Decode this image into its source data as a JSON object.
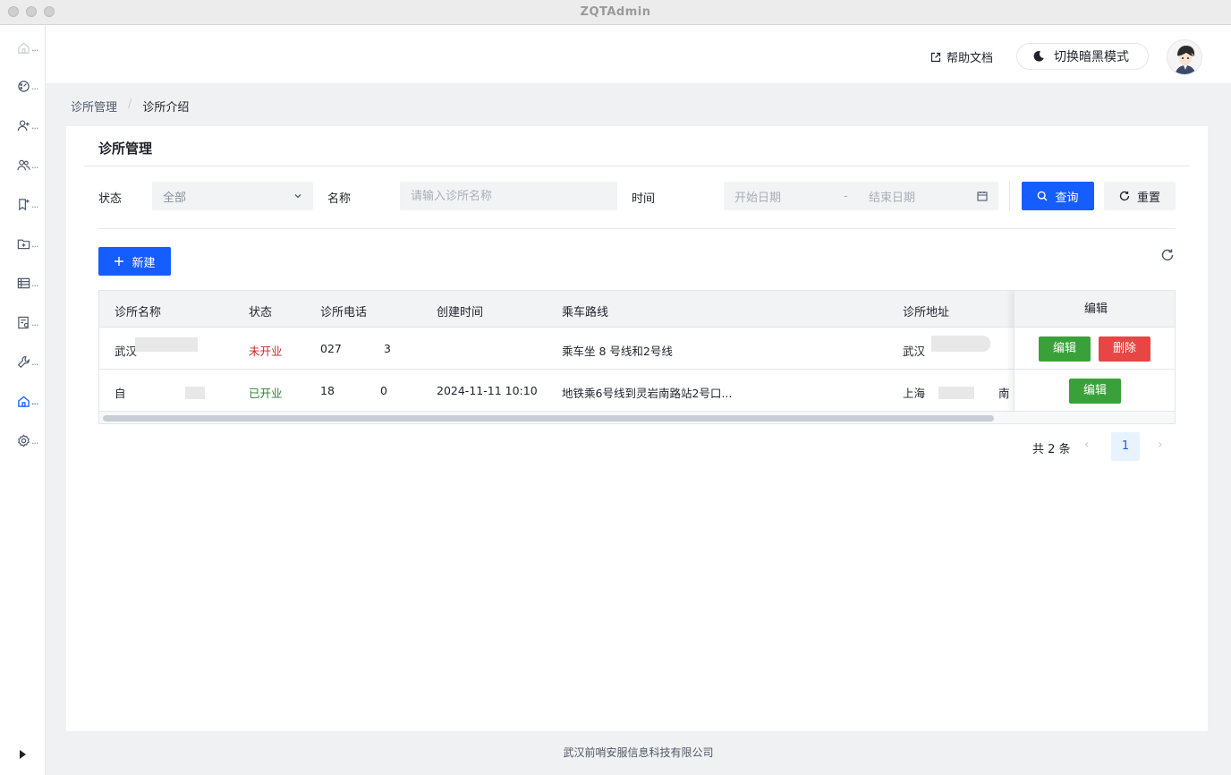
{
  "window": {
    "title": "ZQTAdmin"
  },
  "sidebar": {
    "items": [
      {
        "icon": "home-icon",
        "dots": "..."
      },
      {
        "icon": "dashboard-icon",
        "dots": "..."
      },
      {
        "icon": "user-add-icon",
        "dots": "..."
      },
      {
        "icon": "user-group-icon",
        "dots": "..."
      },
      {
        "icon": "bookmark-add-icon",
        "dots": "..."
      },
      {
        "icon": "folder-add-icon",
        "dots": "..."
      },
      {
        "icon": "table-icon",
        "dots": "..."
      },
      {
        "icon": "form-icon",
        "dots": "..."
      },
      {
        "icon": "tool-icon",
        "dots": "..."
      },
      {
        "icon": "clinic-icon",
        "dots": "...",
        "active": true
      },
      {
        "icon": "settings-icon",
        "dots": "..."
      }
    ],
    "accent": "#165dff"
  },
  "header": {
    "help_label": "帮助文档",
    "dark_mode_label": "切换暗黑模式"
  },
  "breadcrumb": {
    "parent": "诊所管理",
    "separator": "/",
    "current": "诊所介绍"
  },
  "panel": {
    "title": "诊所管理"
  },
  "filters": {
    "status_label": "状态",
    "status_value": "全部",
    "name_label": "名称",
    "name_placeholder": "请输入诊所名称",
    "time_label": "时间",
    "start_placeholder": "开始日期",
    "range_sep": "-",
    "end_placeholder": "结束日期",
    "query_label": "查询",
    "reset_label": "重置"
  },
  "toolbar": {
    "new_label": "新建"
  },
  "table": {
    "headers": {
      "name": "诊所名称",
      "status": "状态",
      "phone": "诊所电话",
      "created": "创建时间",
      "route": "乘车路线",
      "address": "诊所地址",
      "ops": "编辑"
    },
    "rows": [
      {
        "name": "武汉",
        "status": "未开业",
        "status_color": "#c62828",
        "phone_a": "027",
        "phone_b": "3",
        "created": "",
        "route": "乘车坐 8 号线和2号线",
        "address": "武汉",
        "address_tail": "",
        "edit_label": "编辑",
        "delete_label": "删除"
      },
      {
        "name": "自",
        "status": "已开业",
        "status_color": "#2e7d32",
        "phone_a": "18",
        "phone_b": "0",
        "created": "2024-11-11 10:10",
        "route": "地铁乘6号线到灵岩南路站2号口...",
        "address": "上海",
        "address_tail": "南",
        "edit_label": "编辑"
      }
    ]
  },
  "pagination": {
    "total": "共 2 条",
    "current": "1"
  },
  "footer": {
    "company": "武汉前哨安服信息科技有限公司"
  }
}
